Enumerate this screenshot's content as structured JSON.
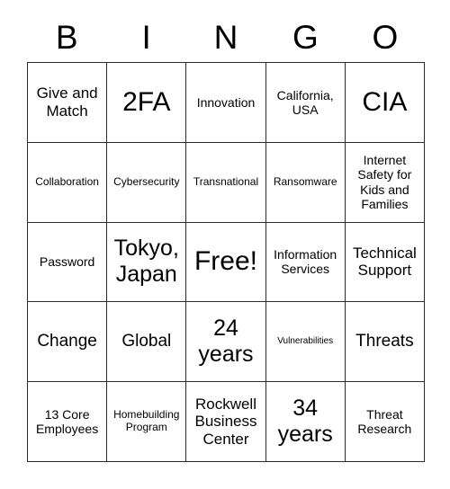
{
  "card": {
    "header_letters": [
      "B",
      "I",
      "N",
      "G",
      "O"
    ],
    "rows": [
      [
        {
          "text": "Give and Match",
          "size": "fs-lg"
        },
        {
          "text": "2FA",
          "size": "fs-3xl"
        },
        {
          "text": "Innovation",
          "size": "fs-md"
        },
        {
          "text": "California, USA",
          "size": "fs-md"
        },
        {
          "text": "CIA",
          "size": "fs-3xl"
        }
      ],
      [
        {
          "text": "Collaboration",
          "size": "fs-sm"
        },
        {
          "text": "Cybersecurity",
          "size": "fs-sm"
        },
        {
          "text": "Transnational",
          "size": "fs-sm"
        },
        {
          "text": "Ransomware",
          "size": "fs-sm"
        },
        {
          "text": "Internet Safety for Kids and Families",
          "size": "fs-md"
        }
      ],
      [
        {
          "text": "Password",
          "size": "fs-md"
        },
        {
          "text": "Tokyo, Japan",
          "size": "fs-2xl"
        },
        {
          "text": "Free!",
          "size": "fs-3xl"
        },
        {
          "text": "Information Services",
          "size": "fs-md"
        },
        {
          "text": "Technical Support",
          "size": "fs-lg"
        }
      ],
      [
        {
          "text": "Change",
          "size": "fs-xl"
        },
        {
          "text": "Global",
          "size": "fs-xl"
        },
        {
          "text": "24 years",
          "size": "fs-2xl"
        },
        {
          "text": "Vulnerabilities",
          "size": "fs-xs"
        },
        {
          "text": "Threats",
          "size": "fs-xl"
        }
      ],
      [
        {
          "text": "13 Core Employees",
          "size": "fs-md"
        },
        {
          "text": "Homebuilding Program",
          "size": "fs-sm"
        },
        {
          "text": "Rockwell Business Center",
          "size": "fs-lg"
        },
        {
          "text": "34 years",
          "size": "fs-2xl"
        },
        {
          "text": "Threat Research",
          "size": "fs-md"
        }
      ]
    ]
  },
  "colors": {
    "border": "#2b2b2b",
    "text": "#000000",
    "background": "#ffffff"
  }
}
